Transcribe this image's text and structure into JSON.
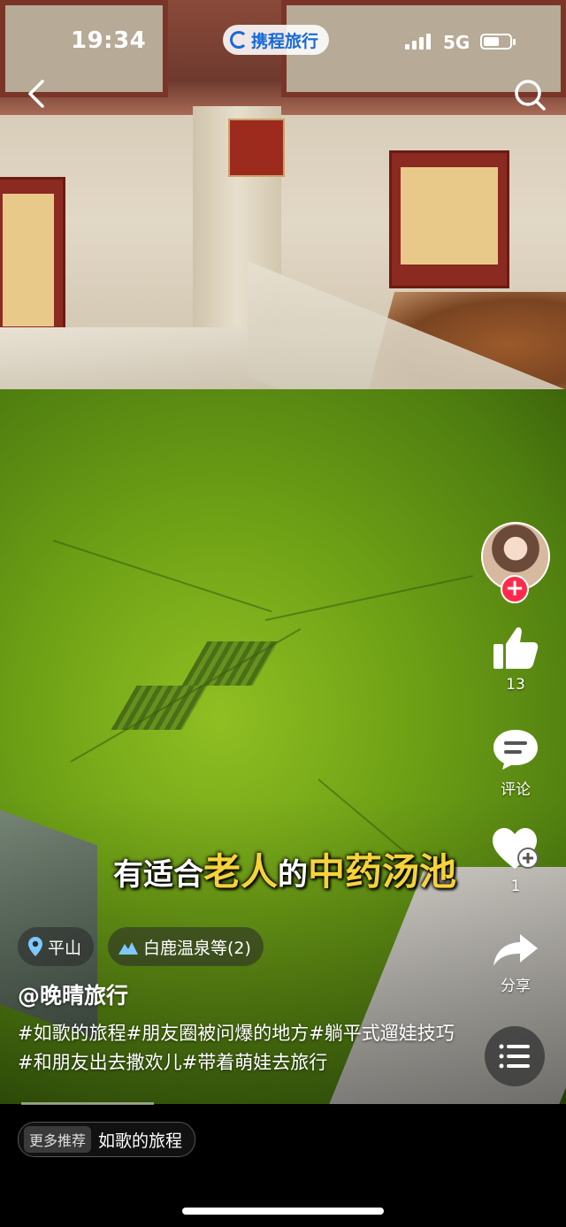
{
  "status_bar": {
    "time": "19:34",
    "app_badge": "携程旅行",
    "network": "5G",
    "battery_level": 0.62
  },
  "nav": {
    "back_icon": "chevron-left-icon",
    "search_icon": "search-icon"
  },
  "video": {
    "subtitle_pre": "有适合",
    "subtitle_hl1": "老人",
    "subtitle_mid": "的",
    "subtitle_hl2": "中药汤池"
  },
  "rail": {
    "likes": "13",
    "comment_label": "评论",
    "favorites": "1",
    "share_label": "分享"
  },
  "post": {
    "location_tag": "平山",
    "poi_tag": "白鹿温泉等(2)",
    "author": "@晚晴旅行",
    "caption": "#如歌的旅程#朋友圈被问爆的地方#躺平式遛娃技巧#和朋友出去撒欢儿#带着萌娃去旅行"
  },
  "bottom": {
    "more_badge": "更多推荐",
    "more_text": "如歌的旅程"
  },
  "colors": {
    "accent_yellow": "#f6d23b",
    "follow_red": "#ff2a4b",
    "brand_blue": "#1869d8"
  }
}
